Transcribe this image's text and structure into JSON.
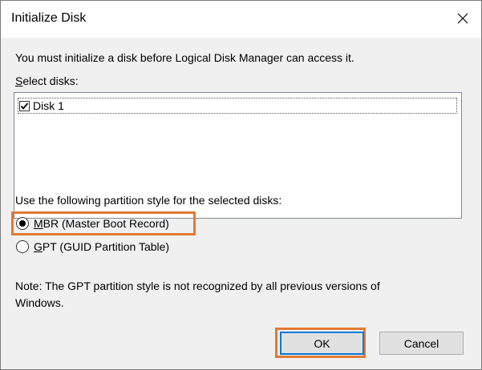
{
  "window": {
    "title": "Initialize Disk",
    "close_icon": "close-icon"
  },
  "dialog": {
    "instruction": "You must initialize a disk before Logical Disk Manager can access it.",
    "select_disks_label_mnemonic": "S",
    "select_disks_label_rest": "elect disks:",
    "disks": [
      {
        "label": "Disk 1",
        "checked": true
      }
    ],
    "partition_style_label": "Use the following partition style for the selected disks:",
    "options": {
      "mbr_mnemonic": "M",
      "mbr_rest": "BR (Master Boot Record)",
      "gpt_mnemonic": "G",
      "gpt_rest": "PT (GUID Partition Table)",
      "selected": "MBR"
    },
    "note_line1": "Note: The GPT partition style is not recognized by all previous versions of",
    "note_line2": "Windows."
  },
  "buttons": {
    "ok_label": "OK",
    "cancel_label": "Cancel"
  },
  "colors": {
    "highlight": "#e07a34",
    "default_button_border": "#0078d7"
  }
}
